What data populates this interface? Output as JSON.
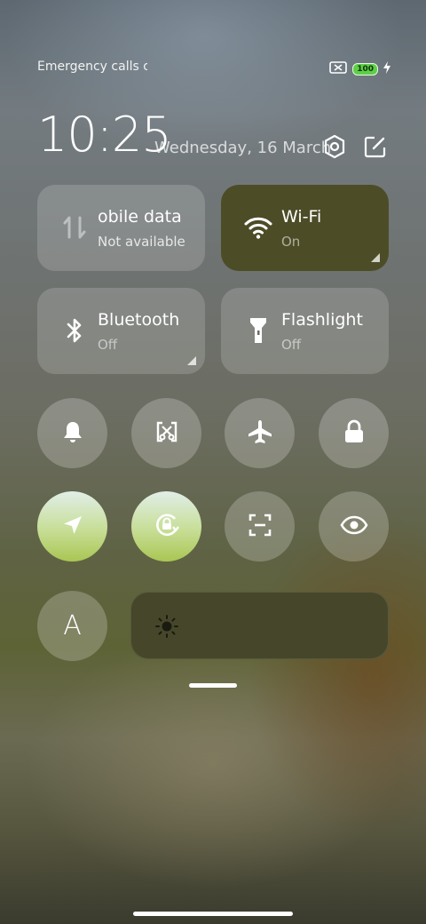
{
  "status_bar": {
    "carrier": "Emergency calls o",
    "battery": "100"
  },
  "header": {
    "time": "10:25",
    "date": "Wednesday, 16 March"
  },
  "tiles": {
    "mobile_data": {
      "label": "obile data",
      "sub": "Not available",
      "active": false
    },
    "wifi": {
      "label": "Wi-Fi",
      "sub": "On",
      "active": true,
      "color": "#4c4d27"
    },
    "bluetooth": {
      "label": "Bluetooth",
      "sub": "Off",
      "active": false
    },
    "flashlight": {
      "label": "Flashlight",
      "sub": "Off",
      "active": false
    }
  },
  "toggles_row1": [
    {
      "icon": "bell-icon",
      "state": "off"
    },
    {
      "icon": "screenshot-crop-icon",
      "state": "off"
    },
    {
      "icon": "airplane-icon",
      "state": "off"
    },
    {
      "icon": "lock-icon",
      "state": "off"
    }
  ],
  "toggles_row2": [
    {
      "icon": "location-arrow-icon",
      "state": "on"
    },
    {
      "icon": "rotation-lock-icon",
      "state": "on"
    },
    {
      "icon": "scan-icon",
      "state": "off"
    },
    {
      "icon": "eye-icon",
      "state": "off"
    }
  ],
  "auto_brightness": {
    "label": "A"
  },
  "brightness": {
    "icon": "sun-icon"
  },
  "accent_colors": {
    "active_tile": "#4c4d27",
    "toggle_on": "#c7de96",
    "battery": "#5bd044"
  }
}
